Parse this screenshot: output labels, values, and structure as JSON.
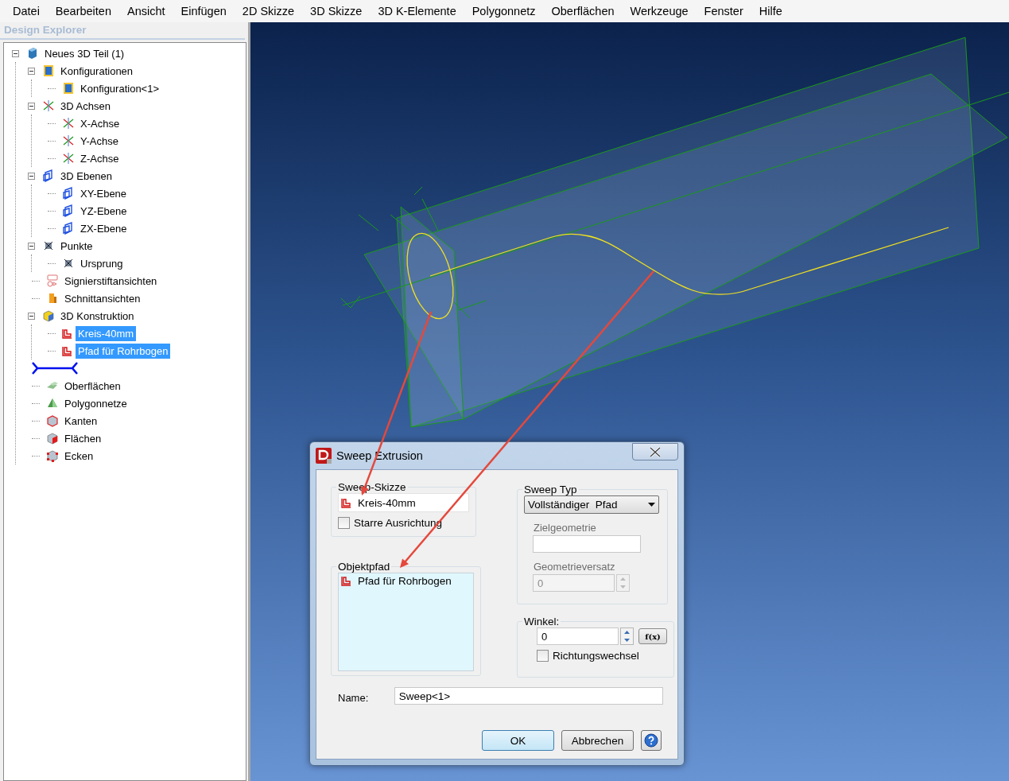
{
  "menu": [
    {
      "label": "Datei"
    },
    {
      "label": "Bearbeiten"
    },
    {
      "label": "Ansicht"
    },
    {
      "label": "Einfügen"
    },
    {
      "label": "2D Skizze"
    },
    {
      "label": "3D Skizze"
    },
    {
      "label": "3D K-Elemente"
    },
    {
      "label": "Polygonnetz"
    },
    {
      "label": "Oberflächen"
    },
    {
      "label": "Werkzeuge"
    },
    {
      "label": "Fenster"
    },
    {
      "label": "Hilfe"
    }
  ],
  "explorer": {
    "title": "Design Explorer",
    "tree": [
      {
        "label": "Neues 3D Teil (1)",
        "kind": "part",
        "expanded": true,
        "selected": false,
        "children": [
          {
            "label": "Konfigurationen",
            "kind": "config",
            "expanded": true,
            "selected": false,
            "children": [
              {
                "label": "Konfiguration<1>",
                "kind": "config",
                "selected": false
              }
            ]
          },
          {
            "label": "3D Achsen",
            "kind": "axes",
            "expanded": true,
            "selected": false,
            "children": [
              {
                "label": "X-Achse",
                "kind": "axes",
                "selected": false
              },
              {
                "label": "Y-Achse",
                "kind": "axes",
                "selected": false
              },
              {
                "label": "Z-Achse",
                "kind": "axes",
                "selected": false
              }
            ]
          },
          {
            "label": "3D Ebenen",
            "kind": "plane",
            "expanded": true,
            "selected": false,
            "children": [
              {
                "label": "XY-Ebene",
                "kind": "plane",
                "selected": false
              },
              {
                "label": "YZ-Ebene",
                "kind": "plane",
                "selected": false
              },
              {
                "label": "ZX-Ebene",
                "kind": "plane",
                "selected": false
              }
            ]
          },
          {
            "label": "Punkte",
            "kind": "point",
            "expanded": true,
            "selected": false,
            "children": [
              {
                "label": "Ursprung",
                "kind": "point",
                "selected": false
              }
            ]
          },
          {
            "label": "Signierstiftansichten",
            "kind": "markup",
            "selected": false
          },
          {
            "label": "Schnittansichten",
            "kind": "section",
            "selected": false
          },
          {
            "label": "3D Konstruktion",
            "kind": "construct",
            "expanded": true,
            "selected": false,
            "children": [
              {
                "label": "Kreis-40mm",
                "kind": "sketch",
                "selected": true
              },
              {
                "label": "Pfad für Rohrbogen",
                "kind": "sketch",
                "selected": true
              }
            ]
          },
          {
            "kind": "connector"
          },
          {
            "label": "Oberflächen",
            "kind": "surface",
            "selected": false
          },
          {
            "label": "Polygonnetze",
            "kind": "mesh",
            "selected": false
          },
          {
            "label": "Kanten",
            "kind": "edges",
            "selected": false
          },
          {
            "label": "Flächen",
            "kind": "faces",
            "selected": false
          },
          {
            "label": "Ecken",
            "kind": "vertices",
            "selected": false
          }
        ]
      }
    ]
  },
  "dialog": {
    "title": "Sweep Extrusion",
    "sweep_sketch": {
      "legend": "Sweep-Skizze",
      "value": "Kreis-40mm",
      "rigid": {
        "label": "Starre Ausrichtung",
        "checked": false
      }
    },
    "object_path": {
      "legend": "Objektpfad",
      "items": [
        "Pfad für Rohrbogen"
      ]
    },
    "sweep_type": {
      "legend": "Sweep Typ",
      "value": "Vollständiger  Pfad",
      "target": {
        "label": "Zielgeometrie",
        "disabled": true
      },
      "offset": {
        "label": "Geometrieversatz",
        "value": "0",
        "disabled": true
      }
    },
    "angle": {
      "legend": "Winkel:",
      "value": "0",
      "formula": "f(x)",
      "reverse": {
        "label": "Richtungswechsel",
        "checked": false
      }
    },
    "name": {
      "label": "Name:",
      "value": "Sweep<1>"
    },
    "buttons": [
      {
        "label": "OK",
        "default": true
      },
      {
        "label": "Abbrechen",
        "default": false
      }
    ]
  }
}
